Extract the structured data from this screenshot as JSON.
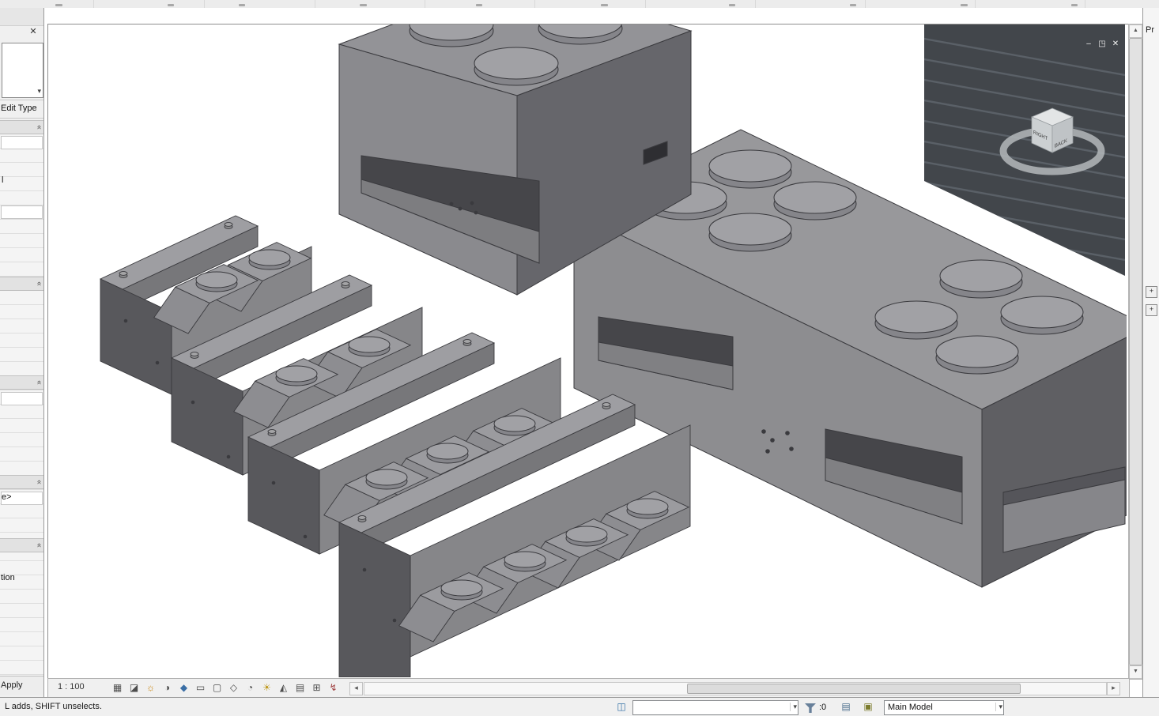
{
  "properties_panel": {
    "close_icon": "✕",
    "type_selector_arrow": "▾",
    "edit_type_label": "Edit Type",
    "collapse_glyph": "«",
    "fragment_row_1": "l",
    "fragment_row_2": "e>",
    "fragment_row_3": "tion",
    "apply_label": "Apply"
  },
  "viewport": {
    "window_controls": {
      "minimize": "–",
      "restore": "◳",
      "close": "✕"
    },
    "viewcube": {
      "left_face": "RIGHT",
      "right_face": "BACK"
    },
    "view_control_bar": {
      "scale": "1 : 100",
      "icons": [
        {
          "name": "detail-level",
          "glyph": "▦"
        },
        {
          "name": "visual-style",
          "glyph": "◪"
        },
        {
          "name": "sun-path",
          "glyph": "☼"
        },
        {
          "name": "shadows",
          "glyph": "◑"
        },
        {
          "name": "rendering-dialog",
          "glyph": "◆"
        },
        {
          "name": "crop-view",
          "glyph": "▭"
        },
        {
          "name": "show-crop-region",
          "glyph": "▢"
        },
        {
          "name": "lock-3d-view",
          "glyph": "◇"
        },
        {
          "name": "temporary-hide-isolate",
          "glyph": "◔"
        },
        {
          "name": "reveal-hidden-elements",
          "glyph": "☀"
        },
        {
          "name": "worksharing-display",
          "glyph": "◭"
        },
        {
          "name": "temporary-view-properties",
          "glyph": "▤"
        },
        {
          "name": "show-analytical-model",
          "glyph": "⊞"
        },
        {
          "name": "highlight-displacement",
          "glyph": "↯"
        }
      ]
    },
    "scrollbar": {
      "up": "▲",
      "down": "▼",
      "left": "◂",
      "right": "▸"
    }
  },
  "right_panel": {
    "title_fragment": "Pr",
    "expand_button_1": "+",
    "expand_button_2": "+"
  },
  "status_bar": {
    "hint": "L adds, SHIFT unselects.",
    "selection_count": ":0",
    "design_option": "Main Model",
    "combo_arrow": "▾"
  }
}
